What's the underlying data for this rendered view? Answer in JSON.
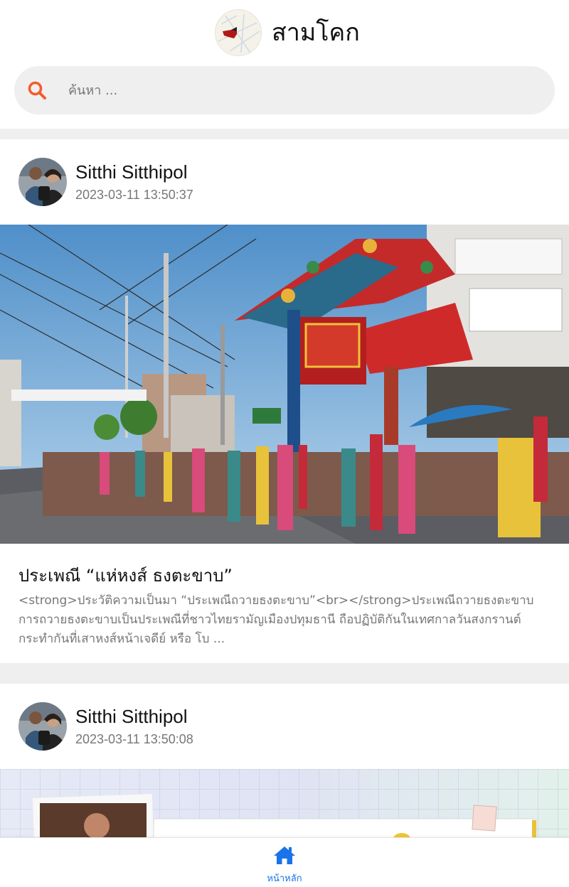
{
  "app": {
    "title": "สามโคก",
    "logo_icon": "map-logo-icon"
  },
  "search": {
    "placeholder": "ค้นหา ...",
    "value": "",
    "icon": "search-icon",
    "icon_color": "#f25c2e"
  },
  "feed": {
    "posts": [
      {
        "author": "Sitthi Sitthipol",
        "timestamp": "2023-03-11 13:50:37",
        "image_alt": "street-procession-photo",
        "title": "ประเพณี “แห่หงส์ ธงตะขาบ”",
        "excerpt": "<strong>ประวัติความเป็นมา “ประเพณีถวายธงตะขาบ”<br></strong>ประเพณีถวายธงตะขาบ การถวายธงตะขาบเป็นประเพณีที่ชาวไทยรามัญเมืองปทุมธานี ถือปฏิบัติกันในเทศกาลวันสงกรานต์ กระทำกันที่เสาหงส์หน้าเจดีย์ หรือ โบ ..."
      },
      {
        "author": "Sitthi Sitthipol",
        "timestamp": "2023-03-11 13:50:08",
        "image_alt": "poster-collage-photo"
      }
    ]
  },
  "nav": {
    "home_label": "หน้าหลัก",
    "home_icon": "home-icon",
    "active_color": "#1a73e8"
  }
}
